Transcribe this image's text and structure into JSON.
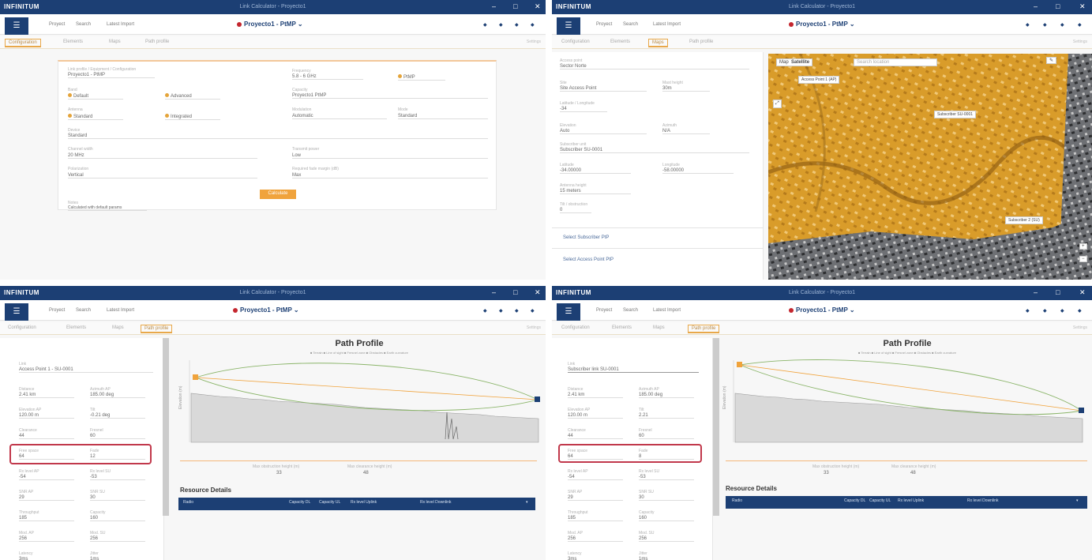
{
  "app": {
    "brand": "INFINITUM",
    "window_title": "Link Calculator - Proyecto1",
    "window_controls": [
      "–",
      "□",
      "✕"
    ],
    "menu": [
      "Proyect",
      "Search",
      "Latest Import"
    ],
    "project": "Proyecto1 - PtMP",
    "project_arrow": "⌄",
    "nav_icons": [
      "◆",
      "◆",
      "◆",
      "◆"
    ],
    "tabs": [
      "Configuration",
      "Elements",
      "Maps",
      "Path profile"
    ],
    "tab_right": "Settings"
  },
  "config": {
    "section_label": "Link profile / Equipment / Configuration",
    "link_name": "Proyecto1 - PtMP",
    "band_label": "Band",
    "band_a": "Default",
    "band_b": "Advanced",
    "frequency_label": "Frequency",
    "frequency_value": "5.8 - 6 GHz",
    "antenna_label": "Antenna",
    "antenna_a": "Standard",
    "antenna_b": "Integrated",
    "capacity_label": "Capacity",
    "capacity_value": "Proyecto1 PtMP",
    "range_label": "Range",
    "range_value": "PtMP",
    "modulation_label": "Modulation",
    "modulation_value": "Automatic",
    "device_label": "Device",
    "device_value": "Standard",
    "mode_label": "Mode",
    "mode_value": "Standard",
    "bandwidth_label": "Channel width",
    "bandwidth_value": "20 MHz",
    "power_label": "Transmit power",
    "power_value": "Low",
    "polarization_label": "Polarization",
    "polarization_value": "Vertical",
    "rx_label": "Required fade margin (dB)",
    "rx_value": "Max",
    "calc_button": "Calculate",
    "footer_label": "Notes",
    "footer_value": "Calculated with default params"
  },
  "map_panel": {
    "fields": [
      {
        "label": "Access point",
        "value": "Sector Norte"
      },
      {
        "label": "Site",
        "value": "Site Access Point",
        "label2": "Mast height",
        "value2": "30m"
      },
      {
        "label": "Latitude / Longitude",
        "value": "-34"
      },
      {
        "label": "Elevation",
        "value": "Auto",
        "label2": "Azimuth",
        "value2": "N/A"
      },
      {
        "label": "Subscriber unit",
        "value": "Subscriber SU-0001"
      },
      {
        "label": "Latitude",
        "value": "-34.00000",
        "label2": "Longitude",
        "value2": "-58.00000"
      },
      {
        "label": "Antenna height",
        "value": "15 meters"
      },
      {
        "label": "Tilt / obstruction",
        "value": "0"
      }
    ],
    "links": [
      "Select Subscriber PtP",
      "Select Access Point PtP"
    ],
    "map_controls": [
      "Map",
      "Satellite"
    ],
    "map_search": "Search location",
    "map_labels": [
      "Access Point 1 (AP)",
      "Subscriber SU-0001",
      "Subscriber 2 (SU)"
    ],
    "zoom": [
      "+",
      "−"
    ]
  },
  "profile_panel": {
    "link_label": "Link",
    "link_value": "Access Point 1 - SU-0001",
    "link_value_alt": "Subscriber link SU-0001",
    "rows": [
      {
        "l1": "Distance",
        "v1": "2.41 km",
        "l2": "Azimuth AP",
        "v2": "185.00 deg"
      },
      {
        "l1": "Elevation AP",
        "v1": "120.00 m",
        "l2": "Tilt",
        "v2": "-0.21 deg"
      },
      {
        "l1": "Clearance",
        "v1": "44",
        "l2": "Fresnel",
        "v2": "60"
      },
      {
        "l1": "Free space",
        "v1": "64",
        "l2": "Fade",
        "v2": "12"
      },
      {
        "l1": "Rx level AP",
        "v1": "-54",
        "l2": "Rx level SU",
        "v2": "-53"
      },
      {
        "l1": "SNR AP",
        "v1": "29",
        "l2": "SNR SU",
        "v2": "30"
      },
      {
        "l1": "Throughput",
        "v1": "185",
        "l2": "Capacity",
        "v2": "160"
      },
      {
        "l1": "Mod. AP",
        "v1": "256",
        "l2": "Mod. SU",
        "v2": "256"
      },
      {
        "l1": "Latency",
        "v1": "3ms",
        "l2": "Jitter",
        "v2": "1ms"
      }
    ],
    "rows_alt": [
      {
        "l1": "Distance",
        "v1": "2.41 km",
        "l2": "Azimuth AP",
        "v2": "185.00 deg"
      },
      {
        "l1": "Elevation AP",
        "v1": "120.00 m",
        "l2": "Tilt",
        "v2": "2.21"
      },
      {
        "l1": "Clearance",
        "v1": "44",
        "l2": "Fresnel",
        "v2": "60"
      },
      {
        "l1": "Free space",
        "v1": "64",
        "l2": "Fade",
        "v2": "8"
      },
      {
        "l1": "Rx level AP",
        "v1": "-54",
        "l2": "Rx level SU",
        "v2": "-53"
      },
      {
        "l1": "SNR AP",
        "v1": "29",
        "l2": "SNR SU",
        "v2": "30"
      },
      {
        "l1": "Throughput",
        "v1": "185",
        "l2": "Capacity",
        "v2": "160"
      },
      {
        "l1": "Mod. AP",
        "v1": "256",
        "l2": "Mod. SU",
        "v2": "256"
      },
      {
        "l1": "Latency",
        "v1": "3ms",
        "l2": "Jitter",
        "v2": "1ms"
      }
    ],
    "chart_title": "Path Profile",
    "legend": "■ Terrain  ■ Line of sight  ■ Fresnel zone  ■ Obstacles  ■ Earth curvature",
    "y_axis_label": "Elevation (m)",
    "stats": [
      {
        "label": "Max obstruction height (m)",
        "value": "33"
      },
      {
        "label": "Max clearance height (m)",
        "value": "48"
      }
    ],
    "results_title": "Resource Details",
    "results_cols": [
      "Radio",
      "Capacity DL",
      "Capacity UL",
      "Rx level Uplink",
      "Rx level Downlink"
    ]
  },
  "chart_data": {
    "type": "area",
    "title": "Path Profile",
    "ylabel": "Elevation (m)",
    "series": [
      {
        "name": "Terrain",
        "values": [
          62,
          60,
          58,
          57,
          55,
          54,
          52,
          51,
          50,
          49,
          48,
          46,
          44,
          43,
          42,
          41,
          40,
          38,
          37,
          36,
          35,
          33,
          32,
          31,
          30
        ]
      }
    ]
  },
  "colors": {
    "navy": "#1c3f74",
    "orange": "#f0a33c",
    "highlight": "#c1384b",
    "fresnel": "#8bb56a"
  }
}
